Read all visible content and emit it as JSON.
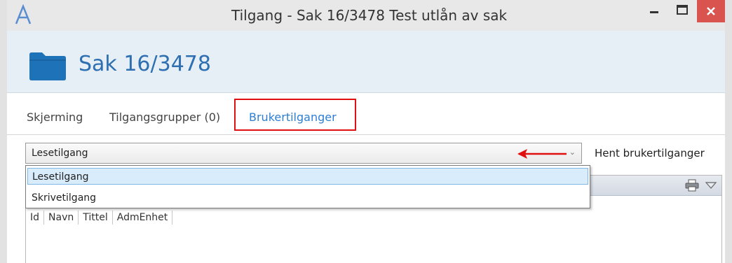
{
  "window": {
    "title": "Tilgang - Sak 16/3478 Test utlån av sak",
    "logo_icon": "app-a-logo-icon",
    "controls": [
      "minimize-icon",
      "maximize-icon",
      "close-icon"
    ],
    "close_color": "#d9534f"
  },
  "header": {
    "icon": "folder-icon",
    "title": "Sak 16/3478",
    "title_color": "#2d6fb0"
  },
  "tabs": [
    {
      "label": "Skjerming"
    },
    {
      "label": "Tilgangsgrupper (0)"
    },
    {
      "label": "Brukertilganger",
      "selected": true,
      "highlight_color": "#e01010"
    }
  ],
  "access_select": {
    "selected": "Lesetilgang",
    "options": [
      "Lesetilgang",
      "Skrivetilgang"
    ],
    "expanded": true
  },
  "fetch_button": {
    "label": "Hent brukertilganger"
  },
  "grid": {
    "columns": [
      "Id",
      "Navn",
      "Tittel",
      "AdmEnhet"
    ],
    "rows": [],
    "toolbar_icons": [
      "printer-icon",
      "dropdown-triangle-icon"
    ]
  },
  "annotation": {
    "arrow_color": "#e01010"
  }
}
